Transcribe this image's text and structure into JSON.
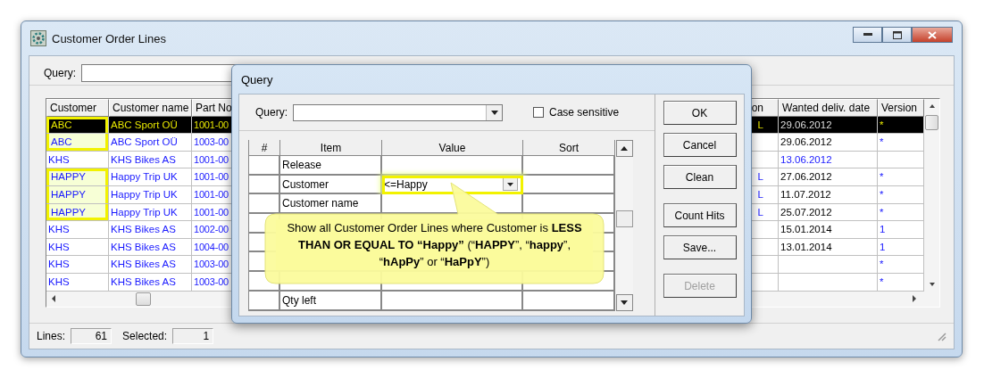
{
  "window": {
    "title": "Customer Order Lines"
  },
  "query": {
    "label": "Query:"
  },
  "table": {
    "columns": [
      {
        "label": "Customer"
      },
      {
        "label": "Customer name"
      },
      {
        "label": "Part No"
      },
      {
        "label": "on"
      },
      {
        "label": "Wanted deliv. date"
      },
      {
        "label": "Version"
      }
    ],
    "rows": [
      {
        "selected": true,
        "highlighted": true,
        "date_marked": false,
        "cells": [
          "ABC",
          "ABC Sport OÜ",
          "1001-00",
          "L",
          "29.06.2012",
          "*"
        ]
      },
      {
        "selected": false,
        "highlighted": true,
        "date_marked": false,
        "cells": [
          "ABC",
          "ABC Sport OÜ",
          "1003-00",
          "",
          "29.06.2012",
          "*"
        ]
      },
      {
        "selected": false,
        "highlighted": false,
        "date_marked": true,
        "cells": [
          "KHS",
          "KHS Bikes AS",
          "1001-00",
          "",
          "13.06.2012",
          ""
        ]
      },
      {
        "selected": false,
        "highlighted": true,
        "date_marked": false,
        "cells": [
          "HAPPY",
          "Happy Trip UK",
          "1001-00",
          "L",
          "27.06.2012",
          "*"
        ]
      },
      {
        "selected": false,
        "highlighted": true,
        "date_marked": false,
        "cells": [
          "HAPPY",
          "Happy Trip UK",
          "1001-00",
          "L",
          "11.07.2012",
          "*"
        ]
      },
      {
        "selected": false,
        "highlighted": true,
        "date_marked": false,
        "cells": [
          "HAPPY",
          "Happy Trip UK",
          "1001-00",
          "L",
          "25.07.2012",
          "*"
        ]
      },
      {
        "selected": false,
        "highlighted": false,
        "date_marked": false,
        "cells": [
          "KHS",
          "KHS Bikes AS",
          "1002-00",
          "",
          "15.01.2014",
          "1"
        ]
      },
      {
        "selected": false,
        "highlighted": false,
        "date_marked": false,
        "cells": [
          "KHS",
          "KHS Bikes AS",
          "1004-00",
          "",
          "13.01.2014",
          "1"
        ]
      },
      {
        "selected": false,
        "highlighted": false,
        "date_marked": false,
        "cells": [
          "KHS",
          "KHS Bikes AS",
          "1003-00",
          "",
          "",
          "*"
        ]
      },
      {
        "selected": false,
        "highlighted": false,
        "date_marked": false,
        "cells": [
          "KHS",
          "KHS Bikes AS",
          "1003-00",
          "",
          "",
          "*"
        ]
      }
    ]
  },
  "status_bar": {
    "lines_label": "Lines:",
    "lines": "61",
    "selected_label": "Selected:",
    "selected": "1"
  },
  "dialog": {
    "title": "Query",
    "query_label": "Query:",
    "case_sensitive": {
      "label": "Case sensitive",
      "checked": false
    },
    "grid": {
      "columns": [
        "#",
        "Item",
        "Value",
        "Sort"
      ],
      "rows": [
        {
          "item": "Release",
          "highlighted": false
        },
        {
          "item": "Customer",
          "value": "<=Happy",
          "highlighted": true
        },
        {
          "item": "Customer name",
          "highlighted": false
        },
        {},
        {},
        {},
        {},
        {
          "item": "Qty left",
          "highlighted": false
        }
      ]
    },
    "buttons": [
      {
        "label": "OK",
        "disabled": false
      },
      {
        "label": "Cancel",
        "disabled": false
      },
      {
        "label": "Clean",
        "disabled": false
      },
      {
        "label": "Count Hits",
        "disabled": false
      },
      {
        "label": "Save...",
        "disabled": false
      },
      {
        "label": "Delete",
        "disabled": true
      }
    ]
  },
  "callout": {
    "text": "Show all Customer Order Lines where Customer is **LESS THAN OR EQUAL TO “Happy”** (“**HAPPY**”, “**happy**”, “**hApPy**” or “**HaPpY**”)"
  }
}
